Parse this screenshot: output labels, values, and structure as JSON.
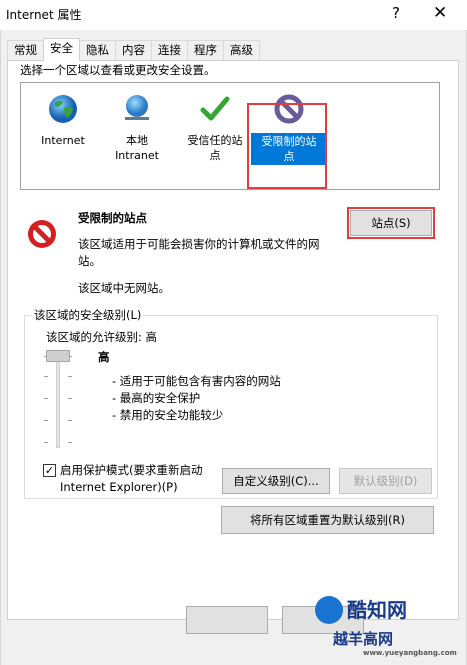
{
  "window": {
    "title": "Internet 属性",
    "help_glyph": "?",
    "close_glyph": "✕"
  },
  "tabs": [
    "常规",
    "安全",
    "隐私",
    "内容",
    "连接",
    "程序",
    "高级"
  ],
  "security": {
    "zone_prompt": "选择一个区域以查看或更改安全设置。",
    "zones": [
      {
        "label": "Internet",
        "icon": "globe-icon"
      },
      {
        "label": "本地\nIntranet",
        "icon": "intranet-globe-icon"
      },
      {
        "label": "受信任的站\n点",
        "icon": "checkmark-icon"
      },
      {
        "label": "受限制的站\n点",
        "icon": "prohibited-icon",
        "selected": true
      }
    ],
    "selected_zone": {
      "title": "受限制的站点",
      "description": "该区域适用于可能会损害你的计算机或文件的网站。",
      "no_sites": "该区域中无网站。",
      "sites_button": "站点(S)"
    },
    "level_group": {
      "legend": "该区域的安全级别(L)",
      "allowed_level": "该区域的允许级别: 高",
      "level_name": "高",
      "bullets": [
        "- 适用于可能包含有害内容的网站",
        "- 最高的安全保护",
        "- 禁用的安全功能较少"
      ],
      "protected_mode_label": "启用保护模式(要求重新启动 Internet Explorer)(P)",
      "protected_mode_checked": true,
      "custom_level_button": "自定义级别(C)...",
      "default_level_button": "默认级别(D)"
    },
    "reset_all_button": "将所有区域重置为默认级别(R)"
  },
  "watermark": {
    "brand_top": "酷知网",
    "brand_bottom": "越羊高网",
    "url": "www.yueyangbang.com"
  },
  "colors": {
    "selection": "#0078d7",
    "annotation_red": "#e23c3c",
    "panel_bg": "#ffffff",
    "dialog_bg": "#f0f0f0"
  }
}
